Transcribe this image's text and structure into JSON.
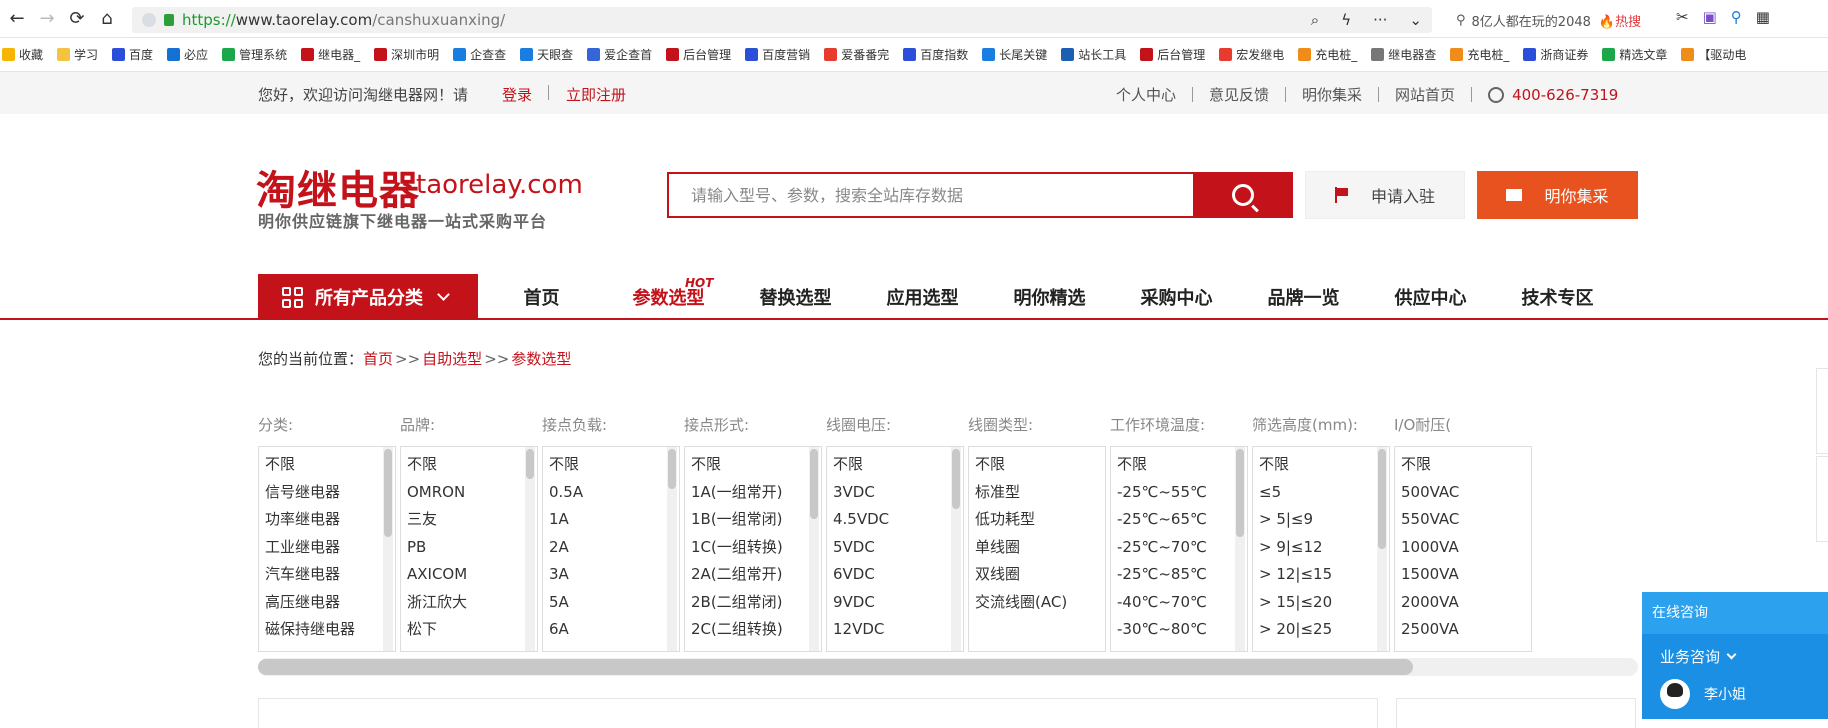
{
  "browser": {
    "url_scheme": "https://",
    "url_host": "www.taorelay.com",
    "url_path": "/canshuxuanxing/",
    "mini_search": "8亿人都在玩的2048",
    "mini_search_hot": "🔥热搜",
    "bookmarks": [
      {
        "label": "收藏",
        "color": "#f7b500"
      },
      {
        "label": "学习",
        "color": "#f5c342"
      },
      {
        "label": "百度",
        "color": "#2b4fd8"
      },
      {
        "label": "必应",
        "color": "#1570d4"
      },
      {
        "label": "管理系统",
        "color": "#1aa84a"
      },
      {
        "label": "继电器_",
        "color": "#c4121a"
      },
      {
        "label": "深圳市明",
        "color": "#c4121a"
      },
      {
        "label": "企查查",
        "color": "#1a7de0"
      },
      {
        "label": "天眼查",
        "color": "#1a7de0"
      },
      {
        "label": "爱企查首",
        "color": "#3466d8"
      },
      {
        "label": "后台管理",
        "color": "#c4121a"
      },
      {
        "label": "百度营销",
        "color": "#2b4fd8"
      },
      {
        "label": "爱番番完",
        "color": "#e63b2e"
      },
      {
        "label": "百度指数",
        "color": "#2b4fd8"
      },
      {
        "label": "长尾关键",
        "color": "#1a7de0"
      },
      {
        "label": "站长工具",
        "color": "#1a5fb4"
      },
      {
        "label": "后台管理",
        "color": "#c4121a"
      },
      {
        "label": "宏发继电",
        "color": "#e63b2e"
      },
      {
        "label": "充电桩_",
        "color": "#f08c1a"
      },
      {
        "label": "继电器查",
        "color": "#777777"
      },
      {
        "label": "充电桩_",
        "color": "#f08c1a"
      },
      {
        "label": "浙商证券",
        "color": "#2b4fd8"
      },
      {
        "label": "精选文章",
        "color": "#1aa84a"
      },
      {
        "label": "【驱动电",
        "color": "#f08c1a"
      }
    ]
  },
  "topbar": {
    "welcome": "您好，欢迎访问淘继电器网！请",
    "login": "登录",
    "register": "立即注册",
    "links": [
      "个人中心",
      "意见反馈",
      "明你集采",
      "网站首页"
    ],
    "phone": "400-626-7319"
  },
  "header": {
    "logo_cn": "淘继电器",
    "logo_en": "taorelay.com",
    "slogan": "明你供应链旗下继电器一站式采购平台",
    "search_placeholder": "请输入型号、参数，搜索全站库存数据",
    "apply_label": "申请入驻",
    "buy_label": "明你集采"
  },
  "nav": {
    "all_categories": "所有产品分类",
    "items": [
      "首页",
      "参数选型",
      "替换选型",
      "应用选型",
      "明你精选",
      "采购中心",
      "品牌一览",
      "供应中心",
      "技术专区"
    ],
    "hot_tag": "HOT",
    "active_index": 1
  },
  "breadcrumb": {
    "prefix": "您的当前位置：",
    "home": "首页",
    "sep": ">>",
    "self_select": "自助选型",
    "current": "参数选型"
  },
  "filters": [
    {
      "title": "分类:",
      "options": [
        "不限",
        "信号继电器",
        "功率继电器",
        "工业继电器",
        "汽车继电器",
        "高压继电器",
        "磁保持继电器"
      ]
    },
    {
      "title": "品牌:",
      "options": [
        "不限",
        "OMRON",
        "三友",
        "PB",
        "AXICOM",
        "浙江欣大",
        "松下"
      ]
    },
    {
      "title": "接点负载:",
      "options": [
        "不限",
        "0.5A",
        "1A",
        "2A",
        "3A",
        "5A",
        "6A"
      ]
    },
    {
      "title": "接点形式:",
      "options": [
        "不限",
        "1A(一组常开)",
        "1B(一组常闭)",
        "1C(一组转换)",
        "2A(二组常开)",
        "2B(二组常闭)",
        "2C(二组转换)"
      ]
    },
    {
      "title": "线圈电压:",
      "options": [
        "不限",
        "3VDC",
        "4.5VDC",
        "5VDC",
        "6VDC",
        "9VDC",
        "12VDC"
      ]
    },
    {
      "title": "线圈类型:",
      "options": [
        "不限",
        "标准型",
        "低功耗型",
        "单线圈",
        "双线圈",
        "交流线圈(AC)"
      ]
    },
    {
      "title": "工作环境温度:",
      "options": [
        "不限",
        "-25℃~55℃",
        "-25℃~65℃",
        "-25℃~70℃",
        "-25℃~85℃",
        "-40℃~70℃",
        "-30℃~80℃"
      ]
    },
    {
      "title": "筛选高度(mm):",
      "options": [
        "不限",
        "≤5",
        "> 5|≤9",
        "> 9|≤12",
        "> 12|≤15",
        "> 15|≤20",
        "> 20|≤25"
      ]
    },
    {
      "title": "I/O耐压(",
      "options": [
        "不限",
        "500VAC",
        "550VAC",
        "1000VA",
        "1500VA",
        "2000VA",
        "2500VA"
      ]
    }
  ],
  "chat": {
    "title": "在线咨询",
    "business": "业务咨询",
    "agent": "李小姐"
  }
}
